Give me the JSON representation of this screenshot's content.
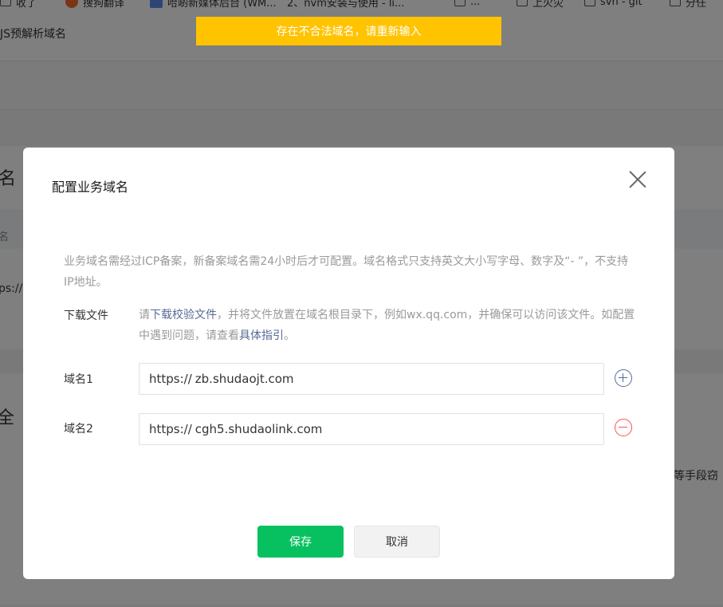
{
  "background": {
    "bookmarks": [
      {
        "label": "收了",
        "icon": "folder-icon"
      },
      {
        "label": "搜狗翻译",
        "icon": "sogou-translate-icon"
      },
      {
        "label": "哈啲新媒体后台 (WM...",
        "icon": "app-icon"
      },
      {
        "label": "2、nvm安装与使用 - li...",
        "icon": "note-icon"
      },
      {
        "label": "...",
        "icon": "folder-icon"
      },
      {
        "label": "上火灾",
        "icon": "folder-icon"
      },
      {
        "label": "svn - git",
        "icon": "folder-icon"
      },
      {
        "label": "分任",
        "icon": "folder-icon"
      }
    ],
    "row_text": "JS预解析域名",
    "section_title_1": "名",
    "row_small_1": "名",
    "row_small_2": "ps://",
    "section_title_2": "全",
    "right_text": "等手段窃"
  },
  "toast": {
    "message": "存在不合法域名，请重新输入"
  },
  "dialog": {
    "title": "配置业务域名",
    "description": "业务域名需经过ICP备案，新备案域名需24小时后才可配置。域名格式只支持英文大小写字母、数字及“- ”，不支持IP地址。",
    "download": {
      "label": "下载文件",
      "text_before": "请",
      "link1": "下载校验文件",
      "text_mid": "，并将文件放置在域名根目录下，例如wx.qq.com，并确保可以访问该文件。如配置中遇到问题，请查看",
      "link2": "具体指引",
      "text_after": "。"
    },
    "domains": [
      {
        "label": "域名1",
        "prefix": "https://",
        "value": "zb.shudaojt.com",
        "action": "add"
      },
      {
        "label": "域名2",
        "prefix": "https://",
        "value": "cgh5.shudaolink.com",
        "action": "remove"
      }
    ],
    "buttons": {
      "save": "保存",
      "cancel": "取消"
    },
    "colors": {
      "primary": "#07c160",
      "link": "#576b95",
      "danger": "#fa5151",
      "toast": "#ffc300"
    }
  }
}
